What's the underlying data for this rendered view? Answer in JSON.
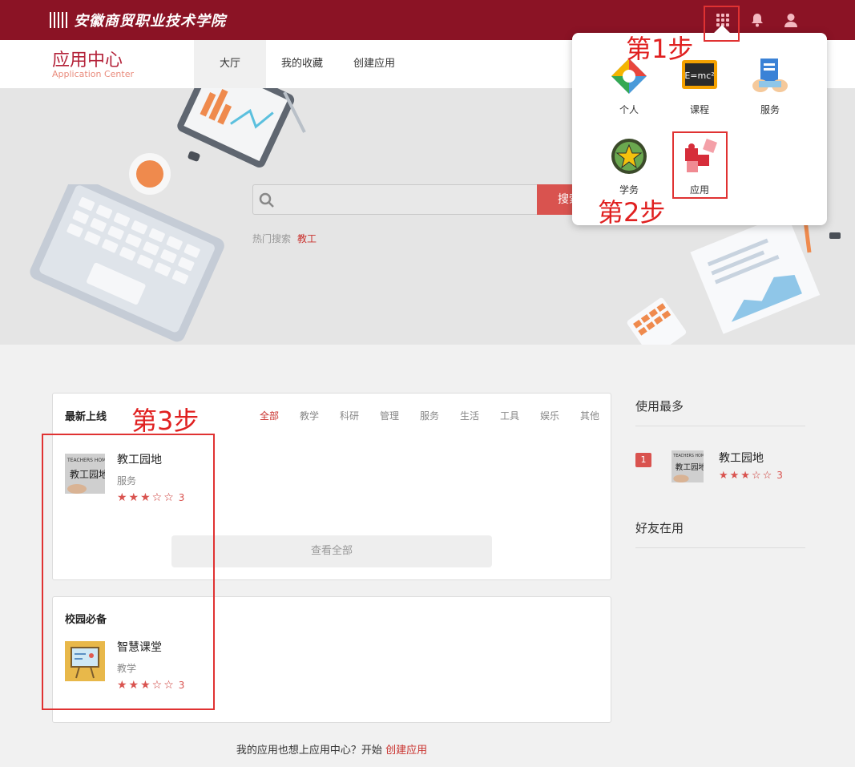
{
  "header": {
    "logo_text": "安徽商贸职业技术学院"
  },
  "app_center": {
    "title": "应用中心",
    "subtitle": "Application Center"
  },
  "nav": {
    "tabs": [
      {
        "label": "大厅",
        "active": true
      },
      {
        "label": "我的收藏",
        "active": false
      },
      {
        "label": "创建应用",
        "active": false
      }
    ]
  },
  "search": {
    "placeholder": "",
    "button_label": "搜索",
    "hot_label": "热门搜索",
    "hot_keyword": "教工"
  },
  "dropdown": {
    "items": [
      {
        "label": "个人",
        "icon": "personal-icon"
      },
      {
        "label": "课程",
        "icon": "course-icon"
      },
      {
        "label": "服务",
        "icon": "service-icon"
      },
      {
        "label": "学务",
        "icon": "student-affairs-icon"
      },
      {
        "label": "应用",
        "icon": "puzzle-app-icon"
      }
    ]
  },
  "annotations": {
    "step1": "第1步",
    "step2": "第2步",
    "step3": "第3步"
  },
  "latest": {
    "title": "最新上线",
    "categories": [
      "全部",
      "教学",
      "科研",
      "管理",
      "服务",
      "生活",
      "工具",
      "娱乐",
      "其他"
    ],
    "active_category": "全部",
    "apps": [
      {
        "name": "教工园地",
        "category": "服务",
        "rating": 3,
        "rating_text": "3"
      }
    ],
    "view_all": "查看全部"
  },
  "campus": {
    "title": "校园必备",
    "apps": [
      {
        "name": "智慧课堂",
        "category": "教学",
        "rating": 3,
        "rating_text": "3"
      }
    ]
  },
  "sidebar": {
    "most_used_title": "使用最多",
    "most_used": [
      {
        "rank": "1",
        "name": "教工园地",
        "rating": 3,
        "rating_text": "3"
      }
    ],
    "friends_title": "好友在用"
  },
  "footer": {
    "prompt": "我的应用也想上应用中心？开始",
    "link": "创建应用"
  },
  "colors": {
    "brand": "#8b1325",
    "accent": "#d9534f",
    "annotation": "#e02020"
  }
}
